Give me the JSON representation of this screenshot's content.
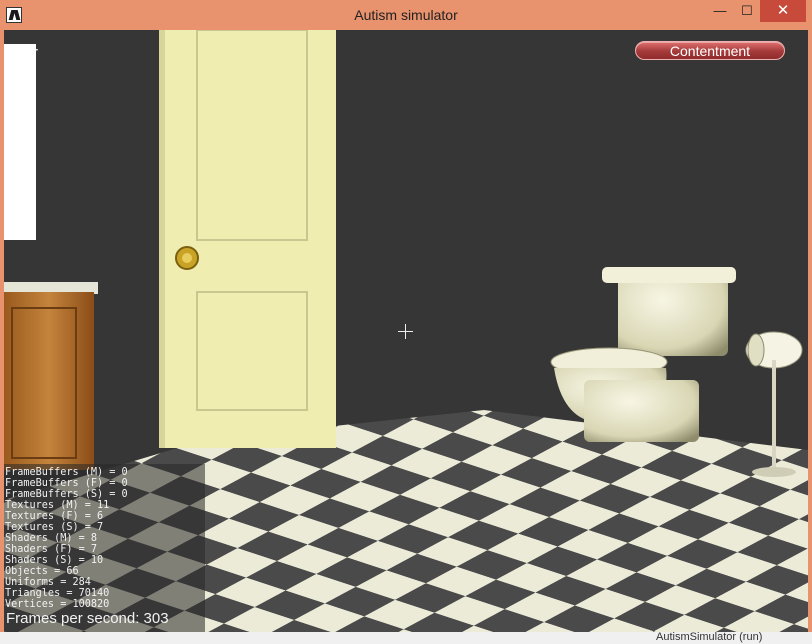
{
  "window": {
    "title": "Autism simulator",
    "minimize_glyph": "—",
    "maximize_glyph": "☐",
    "close_glyph": "✕"
  },
  "hud": {
    "object_label": "door",
    "mood_button": "Contentment",
    "stats": [
      "FrameBuffers (M) = 0",
      "FrameBuffers (F) = 0",
      "FrameBuffers (S) = 0",
      "Textures (M) = 11",
      "Textures (F) = 6",
      "Textures (S) = 7",
      "Shaders (M) = 8",
      "Shaders (F) = 7",
      "Shaders (S) = 10",
      "Objects = 66",
      "Uniforms = 284",
      "Triangles = 70140",
      "Vertices = 100820"
    ],
    "fps": "Frames per second: 303"
  },
  "taskbar": {
    "text": "AutismSimulator (run)"
  },
  "colors": {
    "title_bar": "#e8926e",
    "wall": "#363636",
    "door": "#f2f0b0",
    "mood_button": "#a53a3a"
  }
}
